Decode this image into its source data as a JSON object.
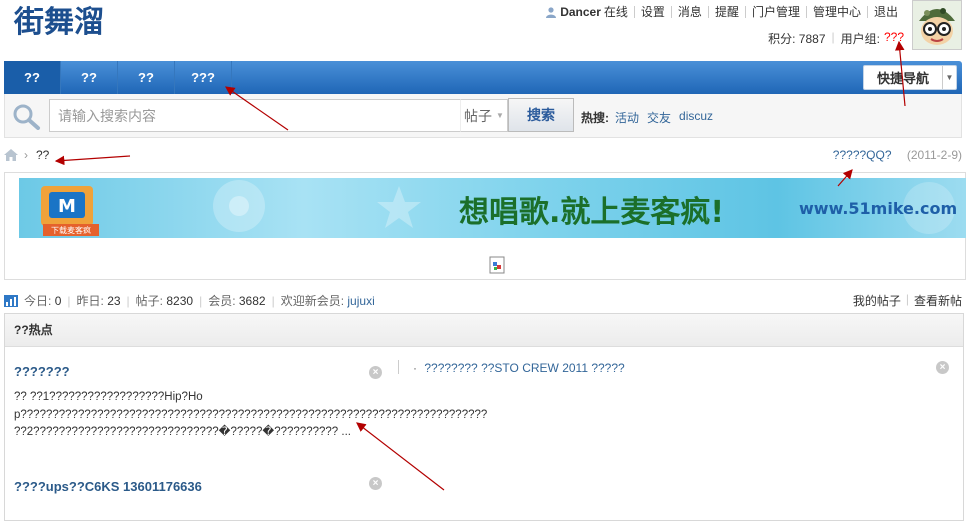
{
  "header": {
    "logo_text": "街舞溜",
    "user": {
      "name": "Dancer",
      "status": "在线"
    },
    "links": [
      "设置",
      "消息",
      "提醒",
      "门户管理",
      "管理中心",
      "退出"
    ],
    "credits_label": "积分: 7887",
    "group_label": "用户组:",
    "group_value": "???"
  },
  "nav": {
    "tabs": [
      "??",
      "??",
      "??",
      "???"
    ],
    "quick_nav": "快捷导航"
  },
  "search": {
    "placeholder": "请输入搜索内容",
    "type": "帖子",
    "button": "搜索",
    "hot_label": "热搜:",
    "hot_keywords": [
      "活动",
      "交友",
      "discuz"
    ]
  },
  "breadcrumb": {
    "current": "??"
  },
  "announcement": {
    "title": "?????QQ?",
    "date": "(2011-2-9)"
  },
  "banner": {
    "badge": "下载麦客疯",
    "slogan": "想唱歌.就上麦客疯!",
    "url": "www.51mike.com"
  },
  "stats": {
    "today_label": "今日:",
    "today": "0",
    "yesterday_label": "昨日:",
    "yesterday": "23",
    "posts_label": "帖子:",
    "posts": "8230",
    "members_label": "会员:",
    "members": "3682",
    "welcome_label": "欢迎新会员:",
    "newest_member": "jujuxi",
    "my_posts": "我的帖子",
    "new_posts": "查看新帖"
  },
  "hot": {
    "heading": "??热点",
    "item1_title": "???????",
    "item1_excerpt": "?? ??1??????????????????Hip?Hop????????????????????????????????????????????????????????????????????????? ??2?????????????????????????????�?????�?????????? ...",
    "item2_title": "????ups??C6KS 13601176636",
    "side_item": "????????  ??STO CREW 2011 ?????",
    "close_glyph": "×",
    "bullet": "·"
  },
  "colors": {
    "nav_blue": "#1f66b6",
    "link_blue": "#336699",
    "group_red": "#ff0000",
    "arrow_red": "#b30000"
  }
}
